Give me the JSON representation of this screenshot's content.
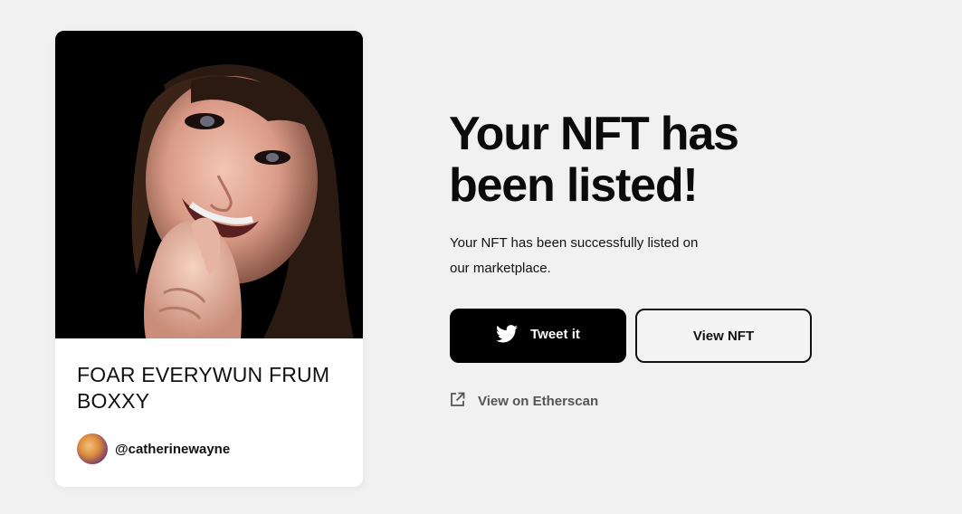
{
  "nft": {
    "title": "FOAR EVERYWUN FRUM BOXXY",
    "creator": "@catherinewayne"
  },
  "main": {
    "headline": "Your NFT has been listed!",
    "description": "Your NFT has been successfully listed on our marketplace.",
    "tweet_label": "Tweet it",
    "view_nft_label": "View NFT",
    "etherscan_label": "View on Etherscan"
  },
  "icons": {
    "tweet_button": "twitter-icon",
    "etherscan_link": "external-link-icon"
  },
  "colors": {
    "background": "#f1f1f1",
    "card": "#ffffff",
    "primary_button": "#000000",
    "text": "#111111",
    "muted_link": "#555555"
  }
}
